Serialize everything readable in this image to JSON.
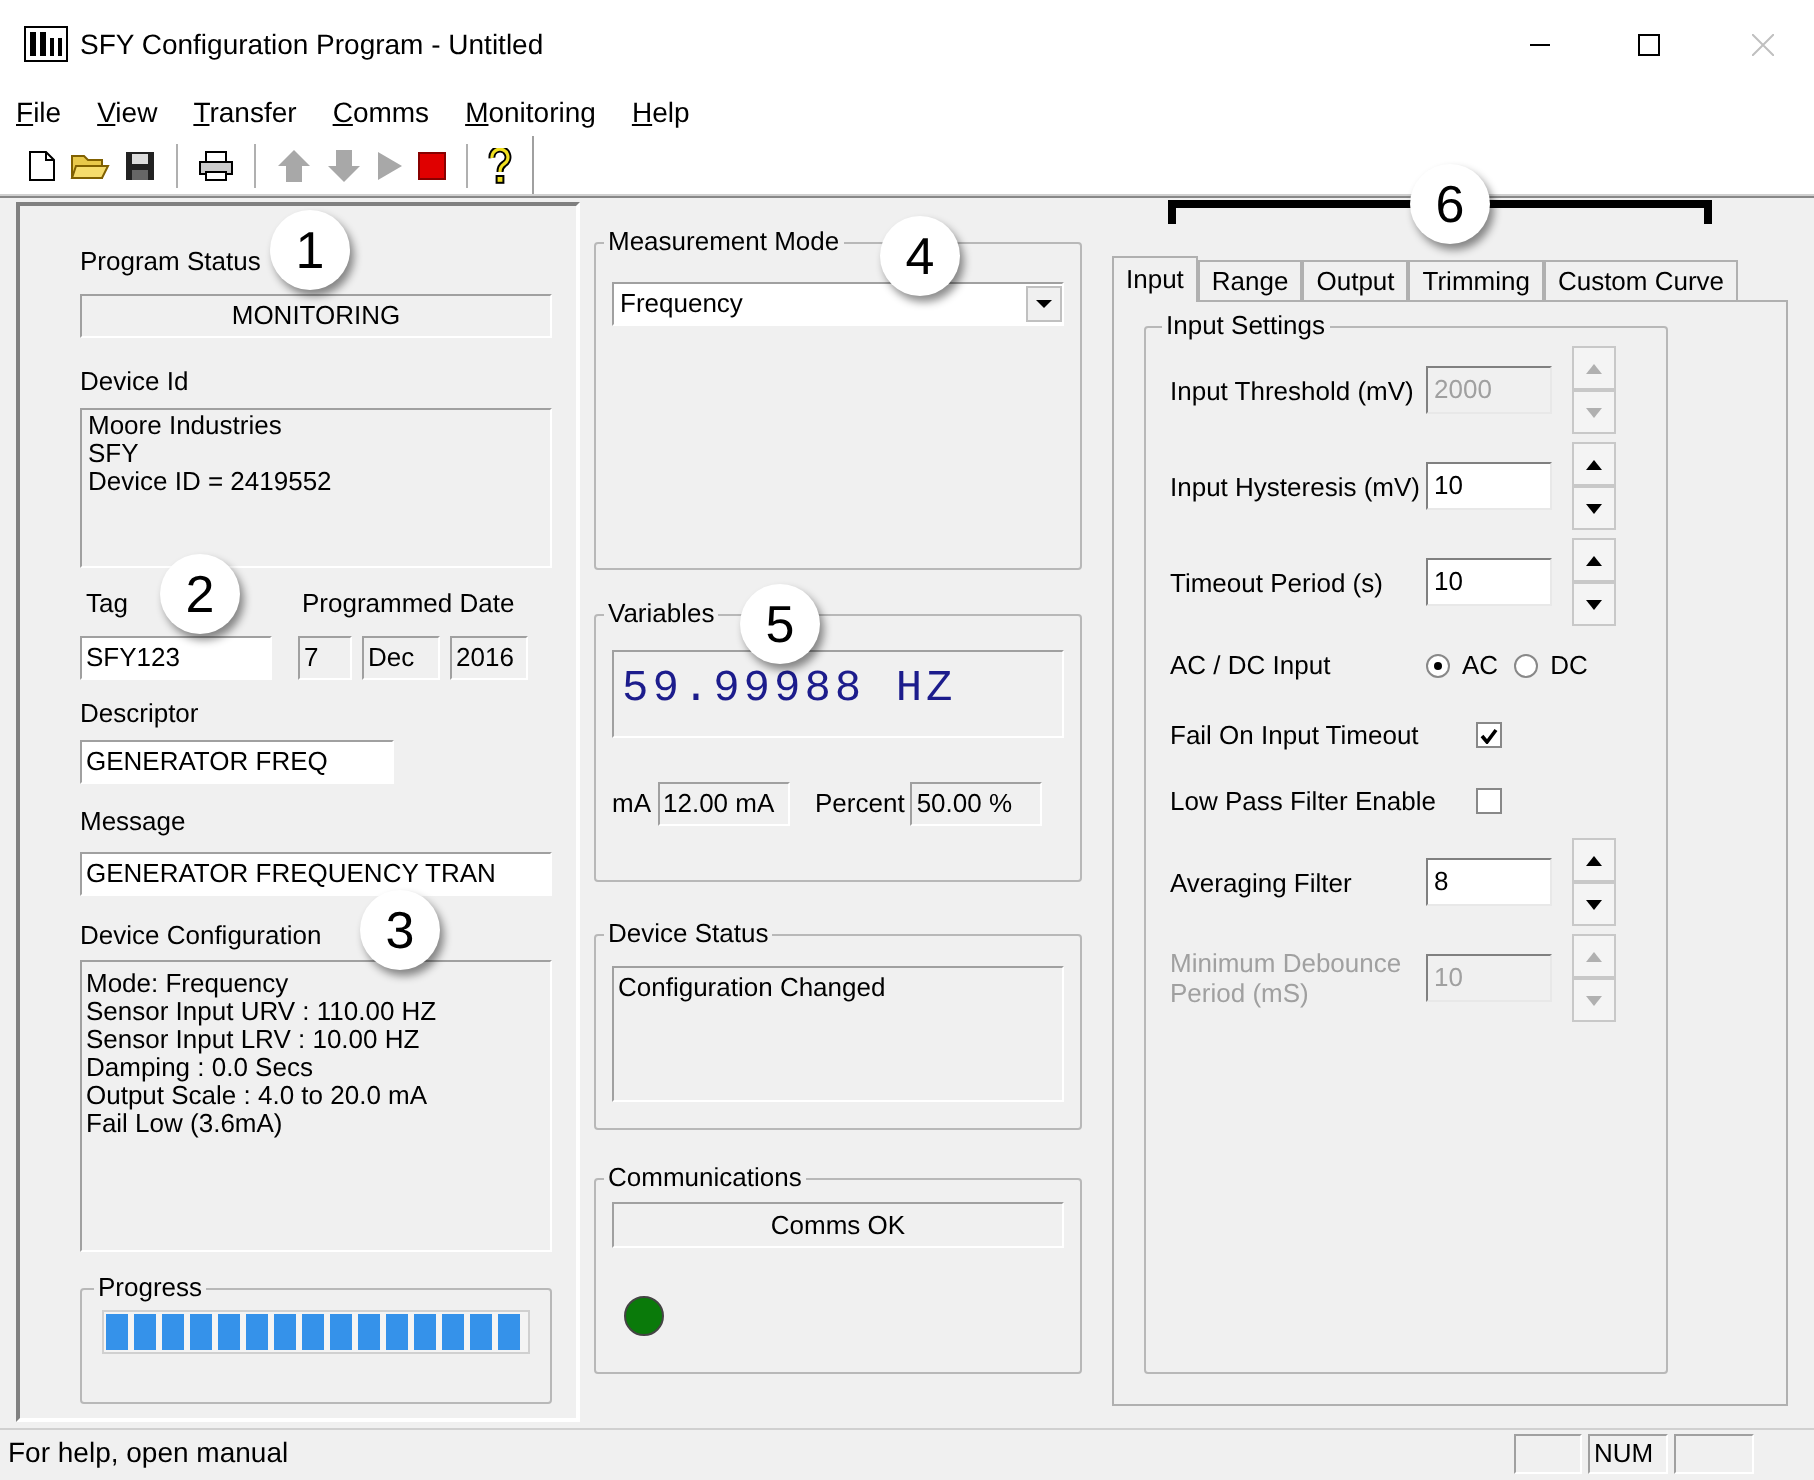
{
  "window": {
    "title": "SFY Configuration Program - Untitled"
  },
  "menu": [
    "File",
    "View",
    "Transfer",
    "Comms",
    "Monitoring",
    "Help"
  ],
  "toolbar": [
    {
      "kind": "new",
      "disabled": false
    },
    {
      "kind": "open"
    },
    {
      "kind": "save"
    },
    {
      "kind": "separator"
    },
    {
      "kind": "print"
    },
    {
      "kind": "separator"
    },
    {
      "kind": "upload",
      "disabled": true
    },
    {
      "kind": "download",
      "disabled": true
    },
    {
      "kind": "play",
      "disabled": true
    },
    {
      "kind": "stop",
      "disabled": false
    },
    {
      "kind": "separator"
    },
    {
      "kind": "help"
    }
  ],
  "program_status": {
    "label": "Program Status",
    "value": "MONITORING"
  },
  "device_id": {
    "label": "Device Id",
    "lines": [
      "Moore Industries",
      "SFY",
      "Device ID = 2419552"
    ]
  },
  "tag": {
    "label": "Tag",
    "value": "SFY123"
  },
  "programmed_date": {
    "label": "Programmed Date",
    "day": "7",
    "month": "Dec",
    "year": "2016"
  },
  "descriptor": {
    "label": "Descriptor",
    "value": "GENERATOR FREQ"
  },
  "message": {
    "label": "Message",
    "value": "GENERATOR FREQUENCY TRAN"
  },
  "device_configuration": {
    "label": "Device Configuration",
    "lines": [
      "Mode: Frequency",
      "Sensor Input URV : 110.00 HZ",
      "Sensor Input LRV : 10.00 HZ",
      "Damping : 0.0 Secs",
      "Output Scale : 4.0 to 20.0 mA",
      "Fail Low (3.6mA)"
    ]
  },
  "progress": {
    "label": "Progress",
    "level": 1
  },
  "measurement_mode": {
    "label": "Measurement Mode",
    "value": "Frequency"
  },
  "variables": {
    "label": "Variables",
    "reading": "59.99988 HZ",
    "ma_label": "mA",
    "ma_value": "12.00 mA",
    "percent_label": "Percent",
    "percent_value": "50.00 %"
  },
  "device_status": {
    "label": "Device Status",
    "value": "Configuration Changed"
  },
  "communications": {
    "label": "Communications",
    "value": "Comms OK",
    "on": true
  },
  "tabs": [
    {
      "label": "Input",
      "selected": true
    },
    {
      "label": "Range",
      "selected": false
    },
    {
      "label": "Output",
      "selected": false
    },
    {
      "label": "Trimming",
      "selected": false
    },
    {
      "label": "Custom Curve",
      "selected": false
    }
  ],
  "input_settings": {
    "label": "Input Settings",
    "rows": [
      {
        "kind": "spin",
        "label": "Input Threshold (mV)",
        "value": "2000",
        "disabled": true,
        "label_disabled": false
      },
      {
        "kind": "spin",
        "label": "Input Hysteresis (mV)",
        "value": "10",
        "disabled": false,
        "label_disabled": false
      },
      {
        "kind": "spin",
        "label": "Timeout Period (s)",
        "value": "10",
        "disabled": false,
        "label_disabled": false
      },
      {
        "kind": "radio",
        "label": "AC / DC Input",
        "options": [
          {
            "label": "AC",
            "selected": true
          },
          {
            "label": "DC",
            "selected": false
          }
        ]
      },
      {
        "kind": "check",
        "label": "Fail On Input Timeout",
        "checked": true
      },
      {
        "kind": "check",
        "label": "Low Pass Filter Enable",
        "checked": false
      },
      {
        "kind": "spin",
        "label": "Averaging Filter",
        "value": "8",
        "disabled": false,
        "label_disabled": false
      },
      {
        "kind": "spin",
        "label": "Minimum Debounce Period (mS)",
        "value": "10",
        "disabled": true,
        "label_disabled": true
      }
    ]
  },
  "callouts": [
    "1",
    "2",
    "3",
    "4",
    "5",
    "6"
  ],
  "status_bar": {
    "text": "For help, open manual",
    "num": "NUM"
  }
}
